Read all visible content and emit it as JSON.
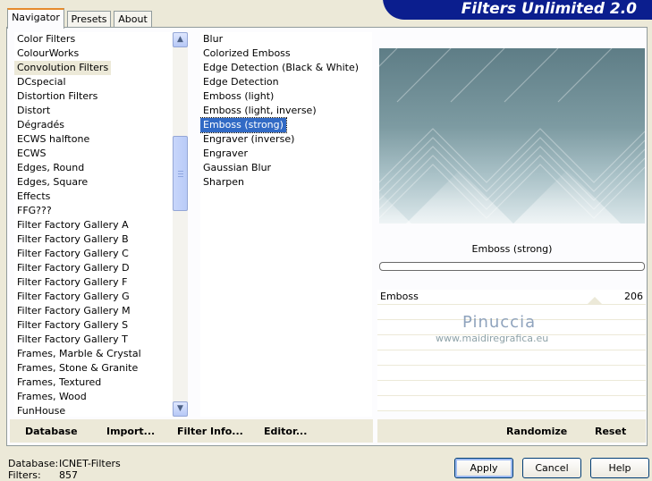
{
  "brand": {
    "title": "Filters Unlimited 2.0"
  },
  "tabs": [
    {
      "label": "Navigator",
      "active": true
    },
    {
      "label": "Presets",
      "active": false
    },
    {
      "label": "About",
      "active": false
    }
  ],
  "categories": {
    "selected": "Convolution Filters",
    "items": [
      "Color Filters",
      "ColourWorks",
      "Convolution Filters",
      "DCspecial",
      "Distortion Filters",
      "Distort",
      "Dégradés",
      "ECWS halftone",
      "ECWS",
      "Edges, Round",
      "Edges, Square",
      "Effects",
      "FFG???",
      "Filter Factory Gallery A",
      "Filter Factory Gallery B",
      "Filter Factory Gallery C",
      "Filter Factory Gallery D",
      "Filter Factory Gallery F",
      "Filter Factory Gallery G",
      "Filter Factory Gallery M",
      "Filter Factory Gallery S",
      "Filter Factory Gallery T",
      "Frames, Marble & Crystal",
      "Frames, Stone & Granite",
      "Frames, Textured",
      "Frames, Wood",
      "FunHouse"
    ]
  },
  "filters": {
    "selected": "Emboss (strong)",
    "items": [
      "Blur",
      "Colorized Emboss",
      "Edge Detection (Black & White)",
      "Edge Detection",
      "Emboss (light)",
      "Emboss (light, inverse)",
      "Emboss (strong)",
      "Engraver (inverse)",
      "Engraver",
      "Gaussian Blur",
      "Sharpen"
    ]
  },
  "preview": {
    "filter_name": "Emboss (strong)"
  },
  "parameters": [
    {
      "label": "Emboss",
      "value": "206",
      "fraction": 0.81
    }
  ],
  "watermark": {
    "line1": "Pinuccia",
    "line2": "www.maidiregrafica.eu"
  },
  "bottom_links": {
    "database": "Database",
    "import": "Import...",
    "filter_info": "Filter Info...",
    "editor": "Editor..."
  },
  "right_actions": {
    "randomize": "Randomize",
    "reset": "Reset"
  },
  "status": {
    "database_label": "Database:",
    "database_value": "ICNET-Filters",
    "filters_label": "Filters:",
    "filters_value": "857"
  },
  "dialog_buttons": {
    "apply": "Apply",
    "cancel": "Cancel",
    "help": "Help"
  },
  "colors": {
    "brand": "#0b1e8e",
    "selection": "#316ac5",
    "face": "#ece9d8"
  }
}
